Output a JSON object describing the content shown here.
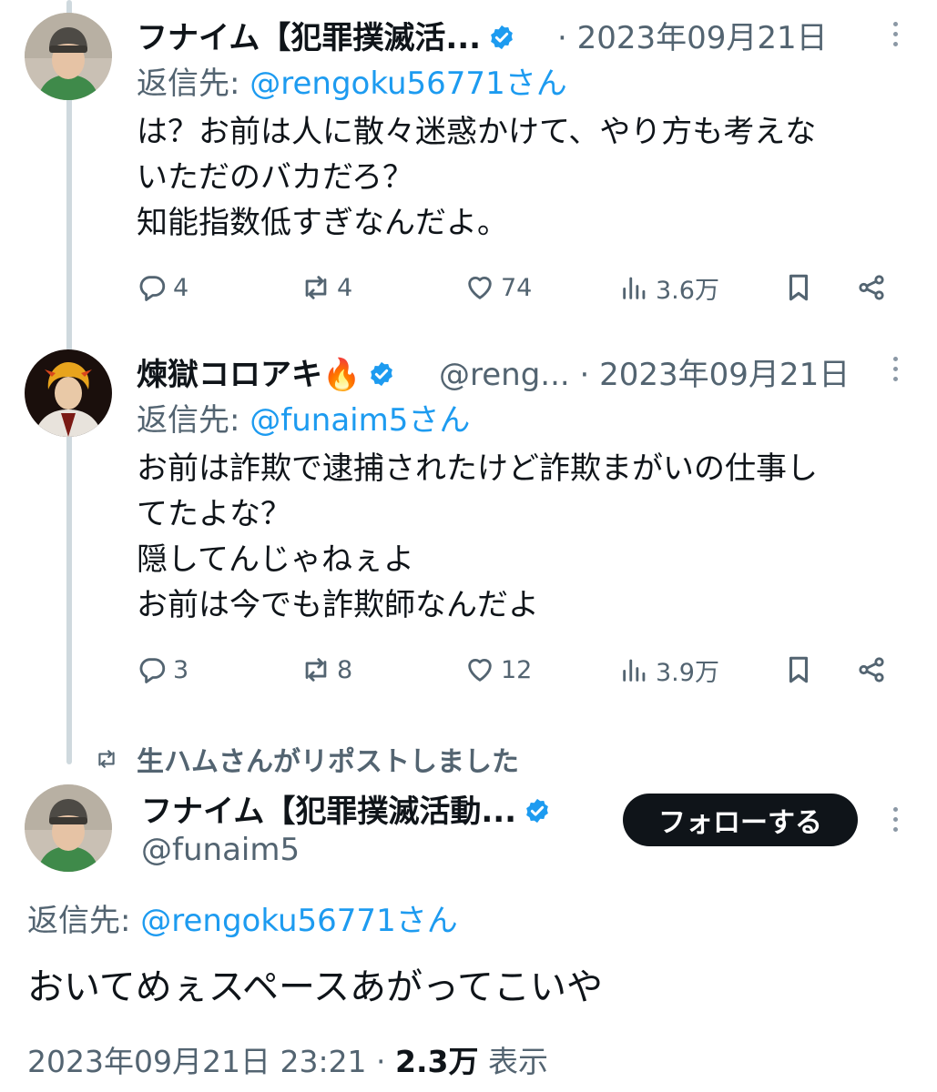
{
  "tweets": [
    {
      "name": "フナイム【犯罪撲滅活...",
      "dot": "·",
      "date": "2023年09月21日",
      "reply_prefix": "返信先: ",
      "reply_to": "@rengoku56771さん",
      "text": "は？お前は人に散々迷惑かけて、やり方も考えな\nいただのバカだろ？\n知能指数低すぎなんだよ。",
      "replies": "4",
      "retweets": "4",
      "likes": "74",
      "views": "3.6万"
    },
    {
      "name": "煉獄コロアキ🔥",
      "handle": "@reng...",
      "dot": "·",
      "date": "2023年09月21日",
      "reply_prefix": "返信先: ",
      "reply_to": "@funaim5さん",
      "text": "お前は詐欺で逮捕されたけど詐欺まがいの仕事し\nてたよな？\n隠してんじゃねぇよ\nお前は今でも詐欺師なんだよ",
      "replies": "3",
      "retweets": "8",
      "likes": "12",
      "views": "3.9万"
    }
  ],
  "repost_notice": "生ハムさんがリポストしました",
  "main_tweet": {
    "name": "フナイム【犯罪撲滅活動...",
    "handle": "@funaim5",
    "follow_label": "フォローする",
    "reply_prefix": "返信先: ",
    "reply_to": "@rengoku56771さん",
    "text": "おいてめぇスペースあがってこいや",
    "timestamp": "2023年09月21日 23:21",
    "dot": " · ",
    "views_count": "2.3万",
    "views_label": " 表示"
  },
  "colors": {
    "accent": "#1d9bf0",
    "secondary_text": "#536471",
    "thread_line": "#cfd9de",
    "follow_button": "#0f1419"
  },
  "icons": [
    "reply-icon",
    "retweet-icon",
    "like-icon",
    "views-icon",
    "bookmark-icon",
    "share-icon",
    "verified-badge-icon",
    "more-icon"
  ]
}
